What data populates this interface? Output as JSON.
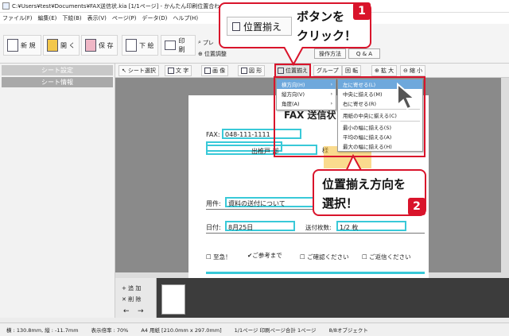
{
  "window": {
    "title": "C:¥Users¥test¥Documents¥FAX送信状.kia [1/1ページ] - かんたん印刷位置合わせ 2"
  },
  "menubar": [
    "ファイル(F)",
    "編集(E)",
    "下絵(B)",
    "表示(V)",
    "ページ(P)",
    "データ(D)",
    "ヘルプ(H)"
  ],
  "toolbar": {
    "new": "新 規",
    "open": "開 く",
    "save": "保 存",
    "underlay": "下 絵",
    "print": "印 刷",
    "preview_partial": "プレ",
    "position_adjust": "位置調整",
    "how_to": "操作方法",
    "qa": "Q & A"
  },
  "left_panel": {
    "sheet_settings": "シート設定",
    "sheet_info": "シート情報"
  },
  "secondary_toolbar": {
    "select": "シート選択",
    "text": "文 字",
    "image": "画 像",
    "shape": "図 形",
    "align": "位置揃え",
    "group": "グループ",
    "rotate": "回 転",
    "zoom_in": "拡 大",
    "zoom_out": "縮 小"
  },
  "align_menu": {
    "items": [
      "横方向(H)",
      "縦方向(V)",
      "角度(A)"
    ],
    "submenu": [
      "左に寄せる(L)",
      "中央に揃える(M)",
      "右に寄せる(R)",
      "用紙の中央に揃える(C)",
      "最小の幅に揃える(S)",
      "平均の幅に揃える(A)",
      "最大の幅に揃える(H)"
    ]
  },
  "document": {
    "fax_title": "FAX 送信状",
    "fax_label": "FAX:",
    "fax_number": "048-111-1111",
    "recipient": "出椎戸 部",
    "recipient_suffix": "様",
    "subject_label": "用件:",
    "subject": "資料の送付について",
    "date_label": "日付:",
    "date": "8月25日",
    "pages_label": "送付枚数:",
    "pages": "1/2 枚",
    "checks": [
      "至急！",
      "ご参考まで",
      "ご確認ください",
      "ご返信ください"
    ]
  },
  "thumbnail_panel": {
    "add": "+ 追 加",
    "delete": "✕ 削 除"
  },
  "statusbar": {
    "coords": "横 : 130.8mm, 縦 : -11.7mm",
    "zoom": "表示倍率 : 70%",
    "paper": "A4 用紙 [210.0mm x 297.0mm]",
    "page": "1/1ページ 印刷ページ合計 1ページ",
    "objects": "8/8オブジェクト"
  },
  "callouts": {
    "step1_button_label": "位置揃え",
    "step1_text_line1": "ボタンを",
    "step1_text_line2": "クリック！",
    "step1_num": "1",
    "step2_text_line1": "位置揃え方向を",
    "step2_text_line2": "選択！",
    "step2_num": "2"
  }
}
